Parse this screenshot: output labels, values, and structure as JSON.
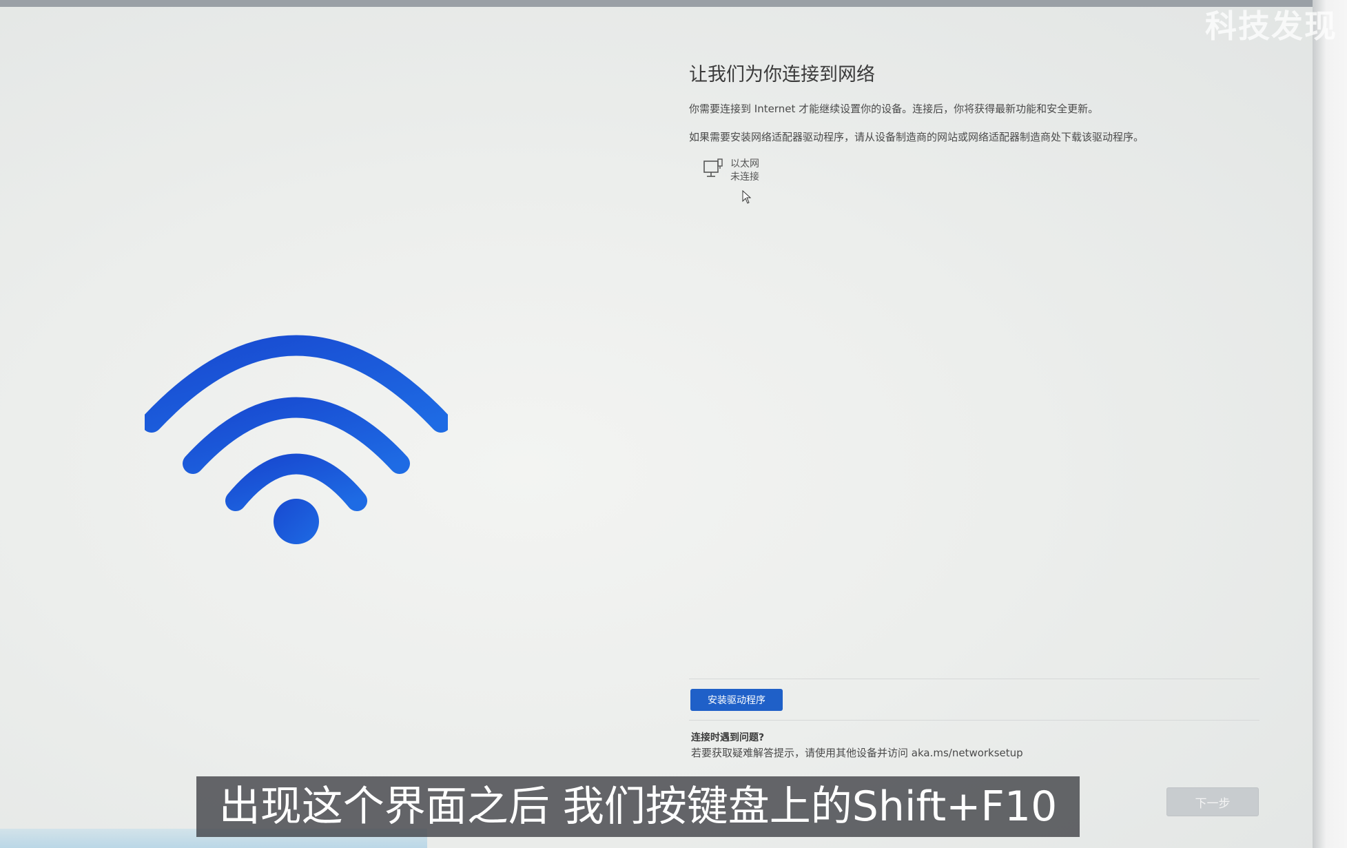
{
  "watermark": "科技发现",
  "page": {
    "title": "让我们为你连接到网络",
    "description_1": "你需要连接到 Internet 才能继续设置你的设备。连接后，你将获得最新功能和安全更新。",
    "description_2": "如果需要安装网络适配器驱动程序，请从设备制造商的网站或网络适配器制造商处下载该驱动程序。"
  },
  "network": {
    "items": [
      {
        "name": "以太网",
        "status": "未连接",
        "icon": "ethernet-icon"
      }
    ]
  },
  "actions": {
    "install_driver_label": "安装驱动程序",
    "next_label": "下一步"
  },
  "help": {
    "title": "连接时遇到问题?",
    "text": "若要获取疑难解答提示，请使用其他设备并访问 aka.ms/networksetup"
  },
  "subtitle": "出现这个界面之后 我们按键盘上的Shift+F10",
  "colors": {
    "accent": "#1f60c8",
    "wifi": "#1a56d6"
  }
}
